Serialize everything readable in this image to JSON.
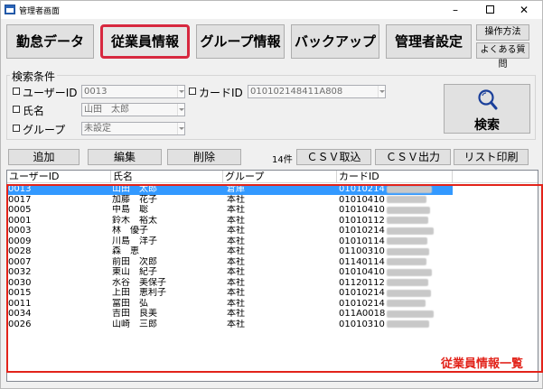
{
  "window": {
    "title": "管理者画面",
    "minimize": "–",
    "close": "✕"
  },
  "nav": {
    "tabs": [
      "勤怠データ",
      "従業員情報",
      "グループ情報",
      "バックアップ",
      "管理者設定"
    ],
    "active_tab": "従業員情報",
    "operation_manual": "操作方法",
    "faq": "よくある質問"
  },
  "search": {
    "legend": "検索条件",
    "user_id_label": "ユーザーID",
    "user_id_value": "0013",
    "card_id_label": "カードID",
    "card_id_value": "010102148411A808",
    "name_label": "氏名",
    "name_value": "山田　太郎",
    "group_label": "グループ",
    "group_value": "未設定",
    "button_label": "検索",
    "icon": "search-icon"
  },
  "actions": {
    "add": "追加",
    "edit": "編集",
    "delete": "削除",
    "count": "14件",
    "csv_import": "ＣＳＶ取込",
    "csv_export": "ＣＳＶ出力",
    "list_print": "リスト印刷"
  },
  "grid": {
    "columns": [
      "ユーザーID",
      "氏名",
      "グループ",
      "カードID"
    ],
    "rows": [
      {
        "id": "0013",
        "name": "山田　太郎",
        "group": "倉庫",
        "card": "01010214"
      },
      {
        "id": "0017",
        "name": "加藤　花子",
        "group": "本社",
        "card": "01010410"
      },
      {
        "id": "0005",
        "name": "中島　聡",
        "group": "本社",
        "card": "01010410"
      },
      {
        "id": "0001",
        "name": "鈴木　裕太",
        "group": "本社",
        "card": "01010112"
      },
      {
        "id": "0003",
        "name": "林　優子",
        "group": "本社",
        "card": "01010214"
      },
      {
        "id": "0009",
        "name": "川島　洋子",
        "group": "本社",
        "card": "01010114"
      },
      {
        "id": "0028",
        "name": "森　恵",
        "group": "本社",
        "card": "01100310"
      },
      {
        "id": "0007",
        "name": "前田　次郎",
        "group": "本社",
        "card": "01140114"
      },
      {
        "id": "0032",
        "name": "東山　紀子",
        "group": "本社",
        "card": "01010410"
      },
      {
        "id": "0030",
        "name": "水谷　美保子",
        "group": "本社",
        "card": "01120112"
      },
      {
        "id": "0015",
        "name": "上田　恵利子",
        "group": "本社",
        "card": "01010214"
      },
      {
        "id": "0011",
        "name": "富田　弘",
        "group": "本社",
        "card": "01010214"
      },
      {
        "id": "0034",
        "name": "吉田　良美",
        "group": "本社",
        "card": "011A0018"
      },
      {
        "id": "0026",
        "name": "山崎　三郎",
        "group": "本社",
        "card": "01010310"
      }
    ],
    "selected_index": 0
  },
  "annotation": {
    "label": "従業員情報一覧",
    "color": "#e2231a"
  },
  "colors": {
    "selection": "#3399ff",
    "highlight": "#d7283f"
  }
}
